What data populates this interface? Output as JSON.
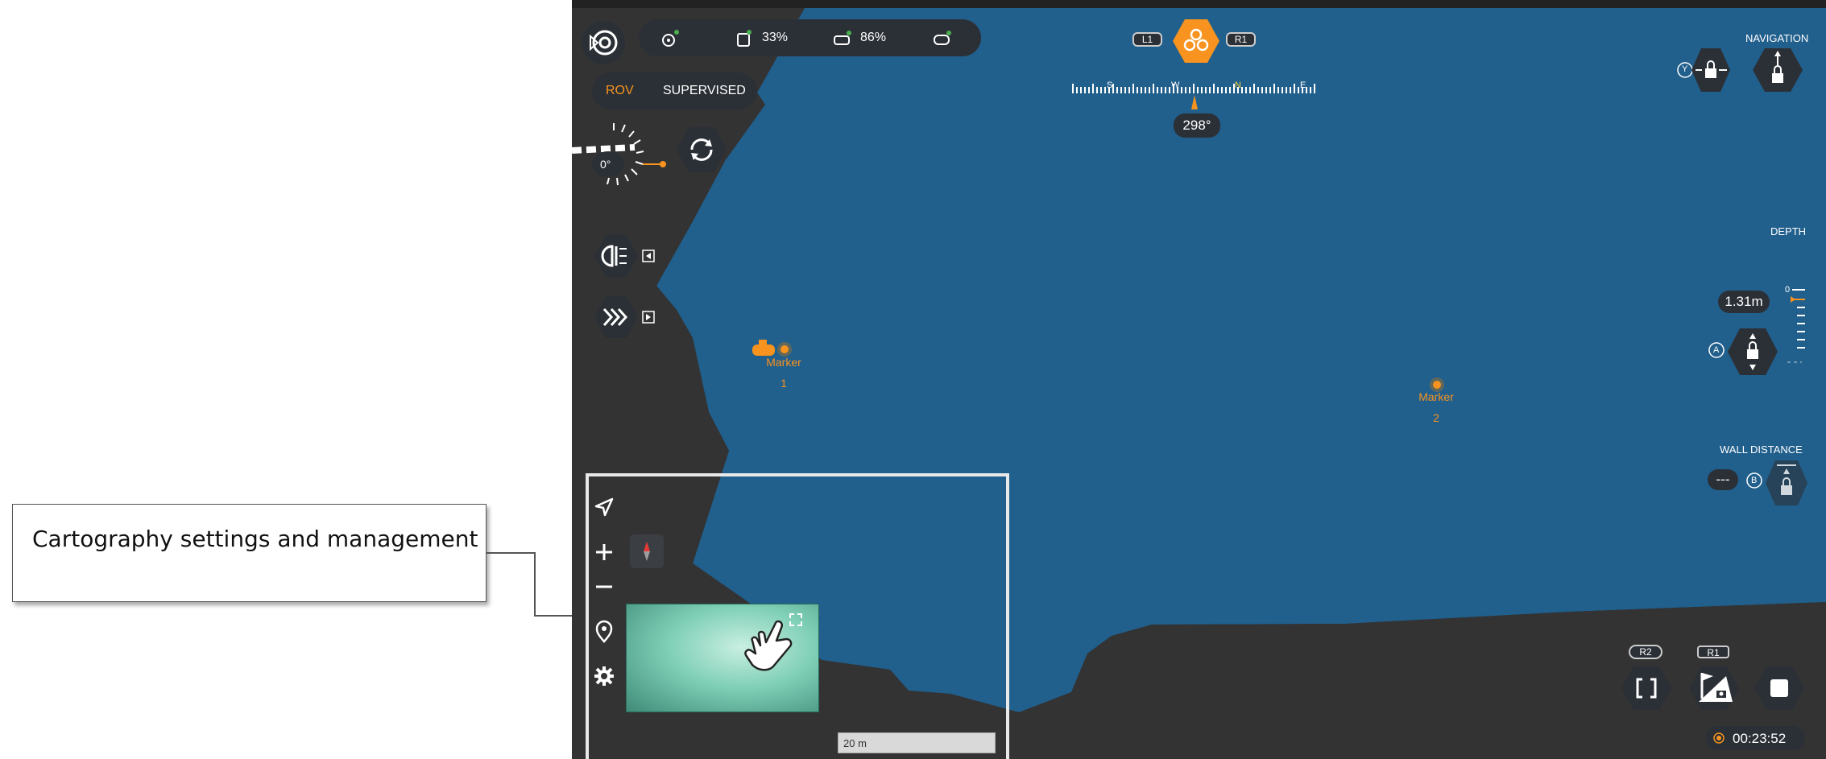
{
  "callout": {
    "text": "Cartography settings and management"
  },
  "status_bar": {
    "battery1": "33%",
    "battery2": "86%"
  },
  "mode": {
    "rov": "ROV",
    "supervised": "SUPERVISED"
  },
  "tilt": {
    "value": "0°"
  },
  "heading": {
    "l1": "L1",
    "r1": "R1",
    "value": "298°",
    "compass_letters": [
      "S",
      "W",
      "N",
      "E"
    ]
  },
  "navigation": {
    "title": "NAVIGATION",
    "y_button": "Y"
  },
  "depth": {
    "title": "DEPTH",
    "value": "1.31m",
    "scale_zero": "0",
    "a_button": "A"
  },
  "wall_distance": {
    "title": "WALL DISTANCE",
    "value": "---",
    "b_button": "B"
  },
  "markers": [
    {
      "label": "Marker",
      "number": "1"
    },
    {
      "label": "Marker",
      "number": "2"
    }
  ],
  "minimap": {
    "scale": "20 m"
  },
  "recording": {
    "r2": "R2",
    "r1": "R1",
    "time": "00:23:52"
  },
  "colors": {
    "water": "#215f8c",
    "land": "#333333",
    "accent": "#f7931e",
    "hud": "#2b3037"
  }
}
